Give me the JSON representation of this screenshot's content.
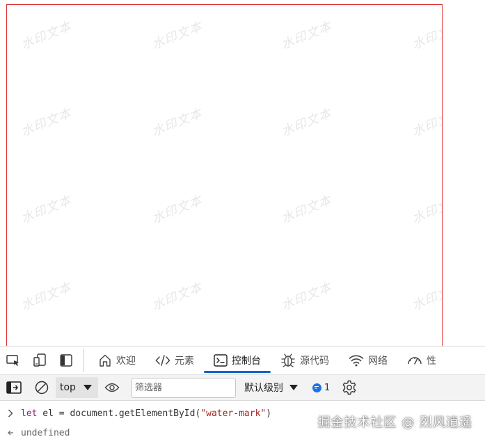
{
  "watermark": {
    "text": "水印文本"
  },
  "devtools": {
    "tabs": [
      {
        "label": "欢迎",
        "icon": "home-icon"
      },
      {
        "label": "元素",
        "icon": "code-icon"
      },
      {
        "label": "控制台",
        "icon": "console-icon",
        "active": true
      },
      {
        "label": "源代码",
        "icon": "bug-icon"
      },
      {
        "label": "网络",
        "icon": "wifi-icon"
      },
      {
        "label": "性",
        "icon": "gauge-icon"
      }
    ],
    "toolbar": {
      "context": "top",
      "filter_placeholder": "筛选器",
      "level": "默认级别",
      "message_count": "1"
    },
    "console": {
      "input": {
        "kw": "let",
        "var": " el = document.getElementById(",
        "str": "\"water-mark\"",
        "close": ")"
      },
      "output": "undefined"
    }
  },
  "credit": "掘金技术社区 @ 烈风逍遥",
  "colors": {
    "accent": "#0a64c8",
    "watermark_border": "#dd3333"
  }
}
